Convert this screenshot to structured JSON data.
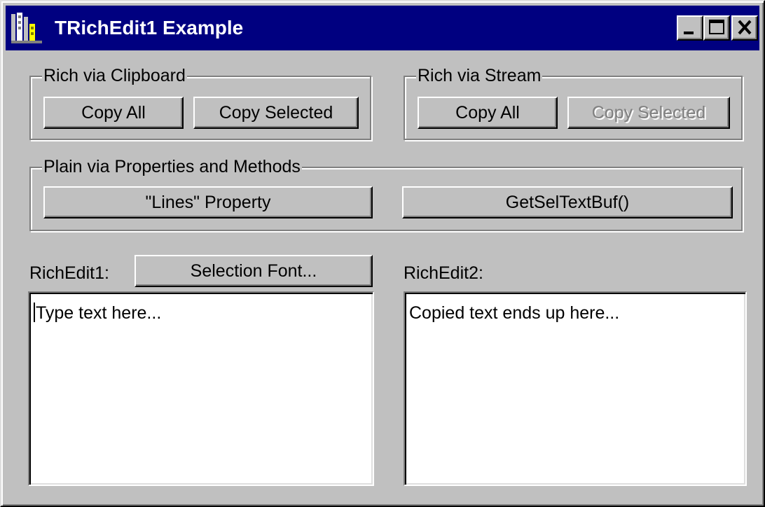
{
  "window": {
    "title": "TRichEdit1 Example",
    "app_icon": "delphi-app-icon",
    "caption_buttons": [
      "minimize-icon",
      "maximize-icon",
      "close-icon"
    ]
  },
  "clipboard_group": {
    "label": "Rich via Clipboard",
    "copy_all": "Copy All",
    "copy_selected": "Copy Selected"
  },
  "stream_group": {
    "label": "Rich via Stream",
    "copy_all": "Copy All",
    "copy_selected": "Copy Selected",
    "copy_selected_enabled": false
  },
  "plain_group": {
    "label": "Plain via Properties and Methods",
    "lines_property": "\"Lines\" Property",
    "get_sel_text_buf": "GetSelTextBuf()"
  },
  "richedit1": {
    "label": "RichEdit1:",
    "font_button": "Selection Font...",
    "text": "Type text here..."
  },
  "richedit2": {
    "label": "RichEdit2:",
    "text": "Copied text ends up here..."
  },
  "colors": {
    "titlebar": "#000080",
    "face": "#c0c0c0",
    "disabled_text": "#808080"
  }
}
